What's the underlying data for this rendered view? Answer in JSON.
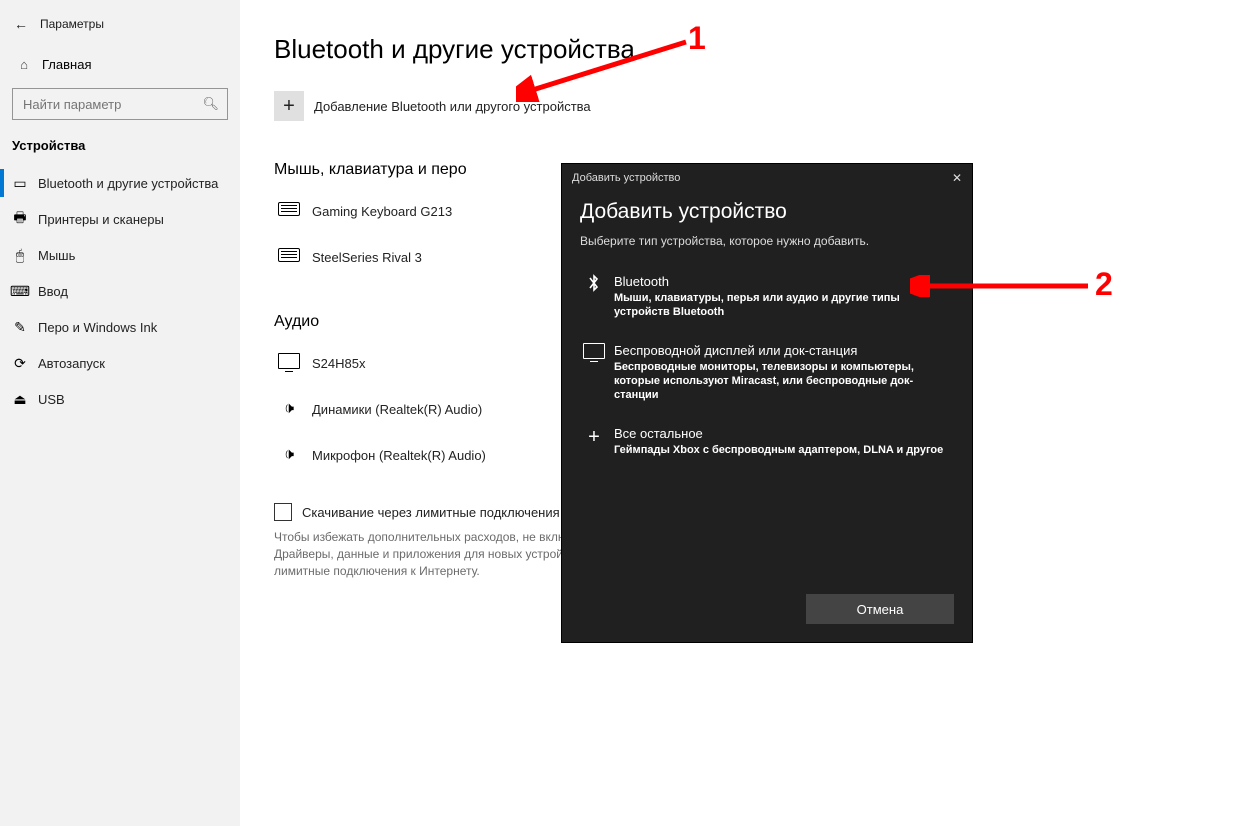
{
  "window_title": "Параметры",
  "sidebar": {
    "home": "Главная",
    "search_placeholder": "Найти параметр",
    "category": "Устройства",
    "items": [
      {
        "label": "Bluetooth и другие устройства",
        "icon": "rect-icon",
        "active": true
      },
      {
        "label": "Принтеры и сканеры",
        "icon": "printer-icon",
        "active": false
      },
      {
        "label": "Мышь",
        "icon": "mouse-icon",
        "active": false
      },
      {
        "label": "Ввод",
        "icon": "keyboard-icon",
        "active": false
      },
      {
        "label": "Перо и Windows Ink",
        "icon": "pen-icon",
        "active": false
      },
      {
        "label": "Автозапуск",
        "icon": "autoplay-icon",
        "active": false
      },
      {
        "label": "USB",
        "icon": "usb-icon",
        "active": false
      }
    ]
  },
  "main": {
    "heading": "Bluetooth и другие устройства",
    "add_device": "Добавление Bluetooth или другого устройства",
    "groups": [
      {
        "title": "Мышь, клавиатура и перо",
        "devices": [
          {
            "name": "Gaming Keyboard G213",
            "icon": "keyboard"
          },
          {
            "name": "SteelSeries Rival 3",
            "icon": "keyboard"
          }
        ]
      },
      {
        "title": "Аудио",
        "devices": [
          {
            "name": "S24H85x",
            "icon": "monitor"
          },
          {
            "name": "Динамики (Realtek(R) Audio)",
            "icon": "speaker"
          },
          {
            "name": "Микрофон (Realtek(R) Audio)",
            "icon": "speaker"
          }
        ]
      }
    ],
    "metered_label": "Скачивание через лимитные подключения",
    "metered_help": "Чтобы избежать дополнительных расходов, не включайте этот параметр. Драйверы, данные и приложения для новых устройств будут скачиваться через лимитные подключения к Интернету."
  },
  "dialog": {
    "titlebar": "Добавить устройство",
    "heading": "Добавить устройство",
    "subtitle": "Выберите тип устройства, которое нужно добавить.",
    "options": [
      {
        "title": "Bluetooth",
        "desc": "Мыши, клавиатуры, перья или аудио и другие типы устройств Bluetooth",
        "icon": "bt"
      },
      {
        "title": "Беспроводной дисплей или док-станция",
        "desc": "Беспроводные мониторы, телевизоры и компьютеры, которые используют Miracast, или беспроводные док-станции",
        "icon": "disp"
      },
      {
        "title": "Все остальное",
        "desc": "Геймпады Xbox с беспроводным адаптером, DLNA и другое",
        "icon": "plus"
      }
    ],
    "cancel": "Отмена"
  },
  "annotations": {
    "n1": "1",
    "n2": "2"
  }
}
